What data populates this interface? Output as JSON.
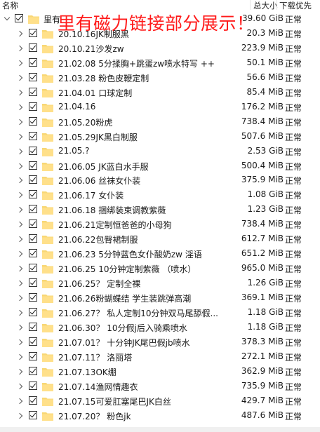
{
  "header": {
    "name": "名称",
    "size": "总大小",
    "priority": "下载优先"
  },
  "overlay": "里有磁力链接部分展示！",
  "root": {
    "name": "里有",
    "size": "39.60 GiB",
    "priority": "正常"
  },
  "items": [
    {
      "name": "20.10.16JK制服黑",
      "size": "20.3 MiB",
      "priority": "正常"
    },
    {
      "name": "20.10.21沙发zw",
      "size": "223.9 MiB",
      "priority": "正常"
    },
    {
      "name": "21.02.08 5分揉胸+跳蛋zw喷水特写 ++",
      "size": "50.1 MiB",
      "priority": "正常"
    },
    {
      "name": "21.03.28 粉色皮鞭定制",
      "size": "56.6 MiB",
      "priority": "正常"
    },
    {
      "name": "21.04.01 口球定制",
      "size": "85.4 MiB",
      "priority": "正常"
    },
    {
      "name": "21.04.16",
      "size": "176.2 MiB",
      "priority": "正常"
    },
    {
      "name": "21.05.20粉虎",
      "size": "738.4 MiB",
      "priority": "正常"
    },
    {
      "name": "21.05.29JK黑白制服",
      "size": "507.6 MiB",
      "priority": "正常"
    },
    {
      "name": "21.05.?",
      "size": "2.53 GiB",
      "priority": "正常"
    },
    {
      "name": "21.06.05 JK蓝白水手服",
      "size": "500.4 MiB",
      "priority": "正常"
    },
    {
      "name": "21.06.06 丝袜女仆装",
      "size": "375.9 MiB",
      "priority": "正常"
    },
    {
      "name": "21.06.17 女仆装",
      "size": "1.08 GiB",
      "priority": "正常"
    },
    {
      "name": "21.06.18 捆绑装束调教紫薇",
      "size": "1.23 GiB",
      "priority": "正常"
    },
    {
      "name": "21.06.21定制恒爸爸的小母狗",
      "size": "738.4 MiB",
      "priority": "正常"
    },
    {
      "name": "21.06.22包臀裙制服",
      "size": "612.7 MiB",
      "priority": "正常"
    },
    {
      "name": "21.06.23 5分钟蓝色女仆酸奶zw 淫语",
      "size": "651.2 MiB",
      "priority": "正常"
    },
    {
      "name": "21.06.25 10分钟定制紫薇 （喷水）",
      "size": "965.0 MiB",
      "priority": "正常"
    },
    {
      "name": "21.06.25？ 定制全裸",
      "size": "1.26 GiB",
      "priority": "正常"
    },
    {
      "name": "21.06.26粉蝴蝶结 学生装跳弹高潮",
      "size": "369.1 MiB",
      "priority": "正常"
    },
    {
      "name": "21.06.27？ 私人定制10分钟双马尾舔假...",
      "size": "1.18 GiB",
      "priority": "正常"
    },
    {
      "name": "21.06.30？ 10分假j后入骑乘喷水",
      "size": "1.18 GiB",
      "priority": "正常"
    },
    {
      "name": "21.07.01？ 十分钟JK尾巴假jb喷水",
      "size": "378.3 MiB",
      "priority": "正常"
    },
    {
      "name": "21.07.11？ 洛丽塔",
      "size": "272.1 MiB",
      "priority": "正常"
    },
    {
      "name": "21.07.13OK绷",
      "size": "362.9 MiB",
      "priority": "正常"
    },
    {
      "name": "21.07.14渔网情趣衣",
      "size": "735.9 MiB",
      "priority": "正常"
    },
    {
      "name": "21.07.15可爱肛塞尾巴JK白丝",
      "size": "429.7 MiB",
      "priority": "正常"
    },
    {
      "name": "21.07.20？ 粉色jk",
      "size": "487.6 MiB",
      "priority": "正常"
    }
  ]
}
